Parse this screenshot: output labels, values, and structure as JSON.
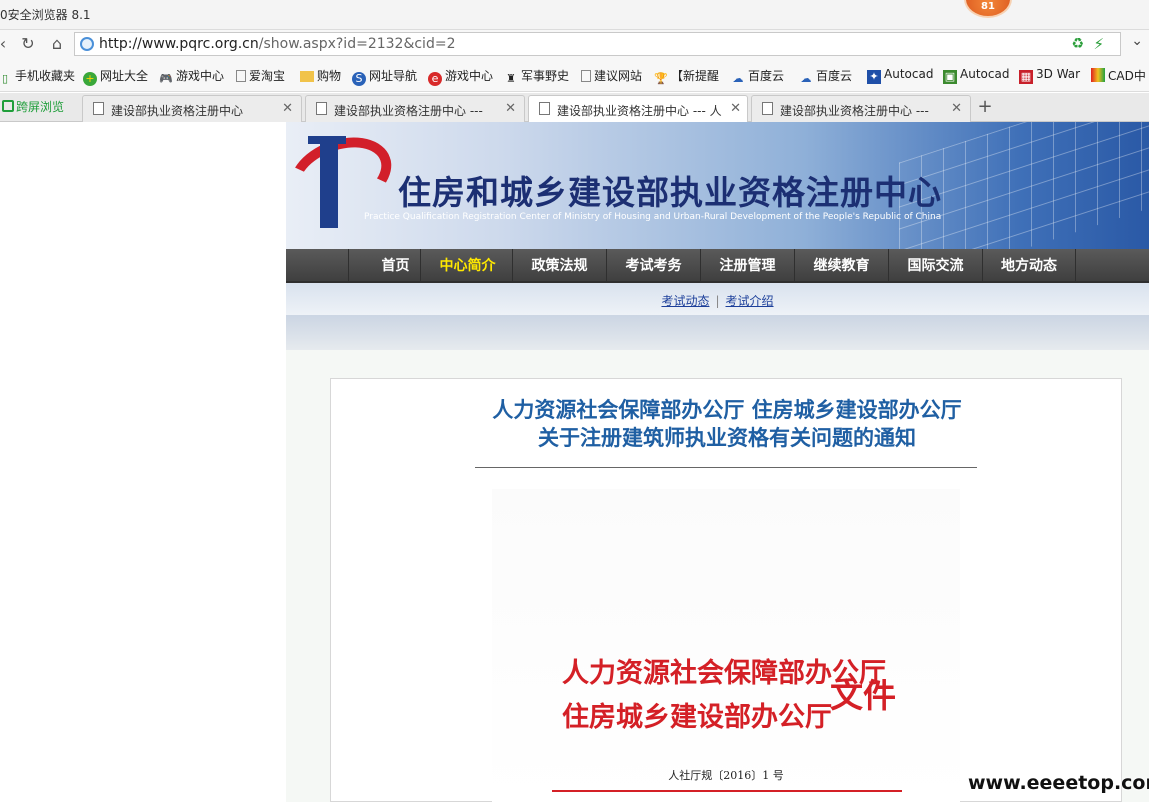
{
  "window": {
    "title": "0安全浏览器 8.1",
    "notification_count": "81"
  },
  "address_bar": {
    "url_host": "http://www.pqrc.org.cn",
    "url_path": "/show.aspx?id=2132&cid=2"
  },
  "bookmarks": [
    {
      "label": "手机收藏夹",
      "icon": "folder-icon"
    },
    {
      "label": "网址大全",
      "icon": "plus-icon"
    },
    {
      "label": "游戏中心",
      "icon": "gamepad-icon"
    },
    {
      "label": "爱淘宝",
      "icon": "page-icon"
    },
    {
      "label": "购物",
      "icon": "folder-icon"
    },
    {
      "label": "网址导航",
      "icon": "s-icon"
    },
    {
      "label": "游戏中心",
      "icon": "e-icon"
    },
    {
      "label": "军事野史",
      "icon": "military-icon"
    },
    {
      "label": "建议网站",
      "icon": "page-icon"
    },
    {
      "label": "【新提醒",
      "icon": "trophy-icon"
    },
    {
      "label": "百度云",
      "icon": "cloud-icon"
    },
    {
      "label": "百度云",
      "icon": "cloud-icon"
    },
    {
      "label": "Autocad",
      "icon": "paw-icon"
    },
    {
      "label": "Autocad",
      "icon": "green-icon"
    },
    {
      "label": "3D War",
      "icon": "red-icon"
    },
    {
      "label": "CAD中",
      "icon": "colorful-icon"
    }
  ],
  "tabs": {
    "split_view_label": "跨屏浏览",
    "items": [
      {
        "label": "建设部执业资格注册中心"
      },
      {
        "label": "建设部执业资格注册中心 ---"
      },
      {
        "label": "建设部执业资格注册中心 --- 人"
      },
      {
        "label": "建设部执业资格注册中心 ---"
      }
    ]
  },
  "site": {
    "title_cn": "住房和城乡建设部执业资格注册中心",
    "title_en": "Practice Qualification Registration Center of Ministry of Housing and Urban-Rural Development of the People's Republic of China",
    "nav": [
      {
        "label": "首页"
      },
      {
        "label": "中心简介"
      },
      {
        "label": "政策法规"
      },
      {
        "label": "考试考务"
      },
      {
        "label": "注册管理"
      },
      {
        "label": "继续教育"
      },
      {
        "label": "国际交流"
      },
      {
        "label": "地方动态"
      }
    ],
    "subnav": [
      {
        "label": "考试动态"
      },
      {
        "label": "考试介绍"
      }
    ],
    "article": {
      "headline_line1": "人力资源社会保障部办公厅  住房城乡建设部办公厅",
      "headline_line2": "关于注册建筑师执业资格有关问题的通知",
      "doc_header_line1": "人力资源社会保障部办公厅",
      "doc_header_line2": "住房城乡建设部办公厅",
      "doc_header_suffix": "文件",
      "doc_number": "人社厅规〔2016〕1 号"
    }
  },
  "watermark": "www.eeeetop.com"
}
